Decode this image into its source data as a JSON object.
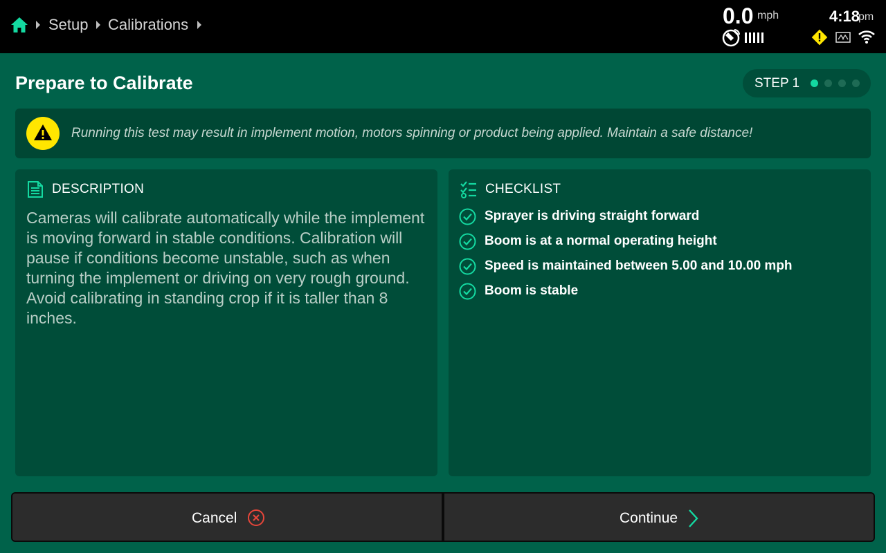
{
  "breadcrumb": {
    "items": [
      "Setup",
      "Calibrations"
    ]
  },
  "status": {
    "speed_value": "0.0",
    "speed_unit": "mph",
    "time_value": "4:18",
    "time_ampm": "pm"
  },
  "icons": {
    "home": "home-icon",
    "gps": "satellite-icon",
    "signal": "signal-strength-icon",
    "alert": "warning-icon",
    "steering": "auto-steer-icon",
    "wifi": "wifi-icon"
  },
  "page": {
    "title": "Prepare to Calibrate",
    "step_label": "STEP 1",
    "step_total": 4,
    "step_current": 1
  },
  "warning": {
    "text": "Running this test may result in implement motion, motors spinning or product being applied. Maintain a safe distance!"
  },
  "description": {
    "header": "DESCRIPTION",
    "text": "Cameras will calibrate automatically while the implement is moving forward in stable conditions. Calibration will pause if conditions become unstable, such as when turning the implement or driving on very rough ground. Avoid calibrating in standing crop if it is taller than 8 inches."
  },
  "checklist": {
    "header": "CHECKLIST",
    "items": [
      "Sprayer is driving straight forward",
      "Boom is at a normal operating height",
      "Speed is maintained between 5.00 and 10.00 mph",
      "Boom is stable"
    ]
  },
  "actions": {
    "cancel_label": "Cancel",
    "continue_label": "Continue"
  },
  "colors": {
    "background": "#00624a",
    "panel": "#004d39",
    "accent": "#14d9a1",
    "warning_yellow": "#ffe600",
    "cancel_red": "#e8463a"
  }
}
